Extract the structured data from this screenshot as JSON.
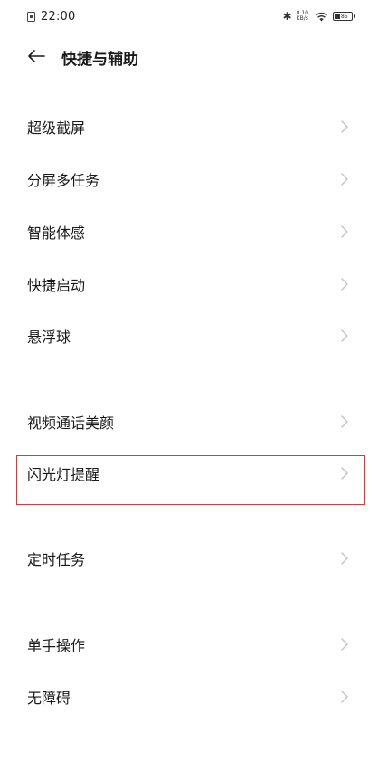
{
  "status_bar": {
    "time": "22:00",
    "net_speed_value": "0.10",
    "net_speed_unit": "KB/s",
    "battery_level": "85"
  },
  "header": {
    "title": "快捷与辅助"
  },
  "items": [
    {
      "label": "超级截屏"
    },
    {
      "label": "分屏多任务"
    },
    {
      "label": "智能体感"
    },
    {
      "label": "快捷启动"
    },
    {
      "label": "悬浮球"
    },
    {
      "label": "视频通话美颜"
    },
    {
      "label": "闪光灯提醒"
    },
    {
      "label": "定时任务"
    },
    {
      "label": "单手操作"
    },
    {
      "label": "无障碍"
    }
  ],
  "colors": {
    "highlight": "#d9363e",
    "chevron": "#c2c2c2"
  },
  "icons": {
    "back": "arrow-left-icon",
    "chevron": "chevron-right-icon"
  }
}
